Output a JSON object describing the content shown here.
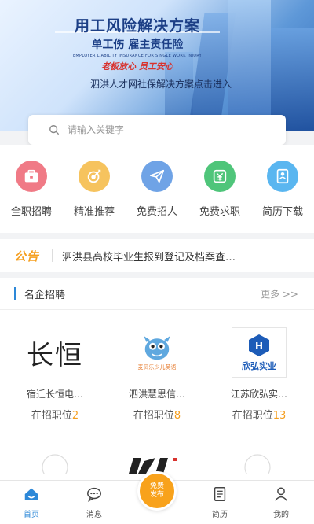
{
  "banner": {
    "title": "用工风险解决方案",
    "subtitle": "单工伤  雇主责任险",
    "english": "EMPLOYER LIABILITY INSURANCE FOR SINGLE WORK INJURY",
    "slogan": "老板放心  员工安心",
    "entry": "泗洪人才网社保解决方案点击进入"
  },
  "search": {
    "placeholder": "请输入关键字"
  },
  "menu": [
    {
      "label": "全职招聘",
      "icon": "briefcase-icon",
      "color": "#f07a86"
    },
    {
      "label": "精准推荐",
      "icon": "target-icon",
      "color": "#f6c35e"
    },
    {
      "label": "免费招人",
      "icon": "paper-plane-icon",
      "color": "#6fa3e6"
    },
    {
      "label": "免费求职",
      "icon": "money-icon",
      "color": "#4fc57a"
    },
    {
      "label": "简历下载",
      "icon": "resume-icon",
      "color": "#5ab6f0"
    }
  ],
  "notice": {
    "tag": "公告",
    "text": "泗洪县高校毕业生报到登记及档案查…"
  },
  "section": {
    "title": "名企招聘",
    "more": "更多 >>"
  },
  "companies": [
    {
      "logo_text": "长恒",
      "name": "宿迁长恒电…",
      "jobs_label": "在招职位",
      "jobs": "2"
    },
    {
      "logo_text": "麦贝乐少儿英语",
      "name": "泗洪慧思信…",
      "jobs_label": "在招职位",
      "jobs": "8"
    },
    {
      "logo_text": "欣弘实业",
      "name": "江苏欣弘实…",
      "jobs_label": "在招职位",
      "jobs": "13"
    }
  ],
  "tabs": [
    {
      "label": "首页",
      "icon": "home-icon"
    },
    {
      "label": "消息",
      "icon": "chat-icon"
    },
    {
      "label": "发布",
      "icon": "publish-icon"
    },
    {
      "label": "简历",
      "icon": "document-icon"
    },
    {
      "label": "我的",
      "icon": "user-icon"
    }
  ],
  "publish_button": {
    "line1": "免费",
    "line2": "发布"
  },
  "colors": {
    "accent": "#2d88d8",
    "orange": "#f59f20",
    "publish": "#f8a21c"
  }
}
